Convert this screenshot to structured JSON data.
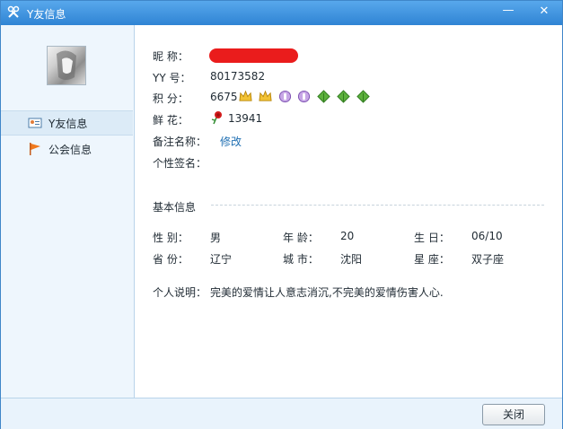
{
  "window": {
    "title": "Y友信息",
    "minimize_symbol": "—",
    "close_symbol": "✕"
  },
  "sidebar": {
    "items": [
      {
        "label": "Y友信息",
        "icon": "profile-card-icon"
      },
      {
        "label": "公会信息",
        "icon": "flag-icon"
      }
    ]
  },
  "profile": {
    "nickname_label": "昵    称：",
    "yy_label": "YY    号：",
    "yy_value": "80173582",
    "points_label": "积    分：",
    "points_value": "6675",
    "badges": [
      "crown-icon",
      "crown-icon",
      "purple-gem-icon",
      "purple-gem-icon",
      "green-leaf-icon",
      "green-leaf-icon",
      "green-leaf-icon"
    ],
    "flowers_label": "鲜    花：",
    "flowers_value": "13941",
    "remark_label": "备注名称：",
    "remark_link": "修改",
    "signature_label": "个性签名："
  },
  "basic_info": {
    "section_title": "基本信息",
    "gender_label": "性    别：",
    "gender_value": "男",
    "age_label": "年    龄：",
    "age_value": "20",
    "birthday_label": "生    日：",
    "birthday_value": "06/10",
    "province_label": "省    份：",
    "province_value": "辽宁",
    "city_label": "城    市：",
    "city_value": "沈阳",
    "zodiac_label": "星    座：",
    "zodiac_value": "双子座",
    "intro_label": "个人说明：",
    "intro_value": "完美的爱情让人意志消沉,不完美的爱情伤害人心."
  },
  "footer": {
    "close_button": "关闭"
  },
  "colors": {
    "titlebar": "#3a8fdb",
    "sidebar_bg": "#eef6fd",
    "link": "#1f6fb2",
    "redacted": "#ea1c1c"
  }
}
